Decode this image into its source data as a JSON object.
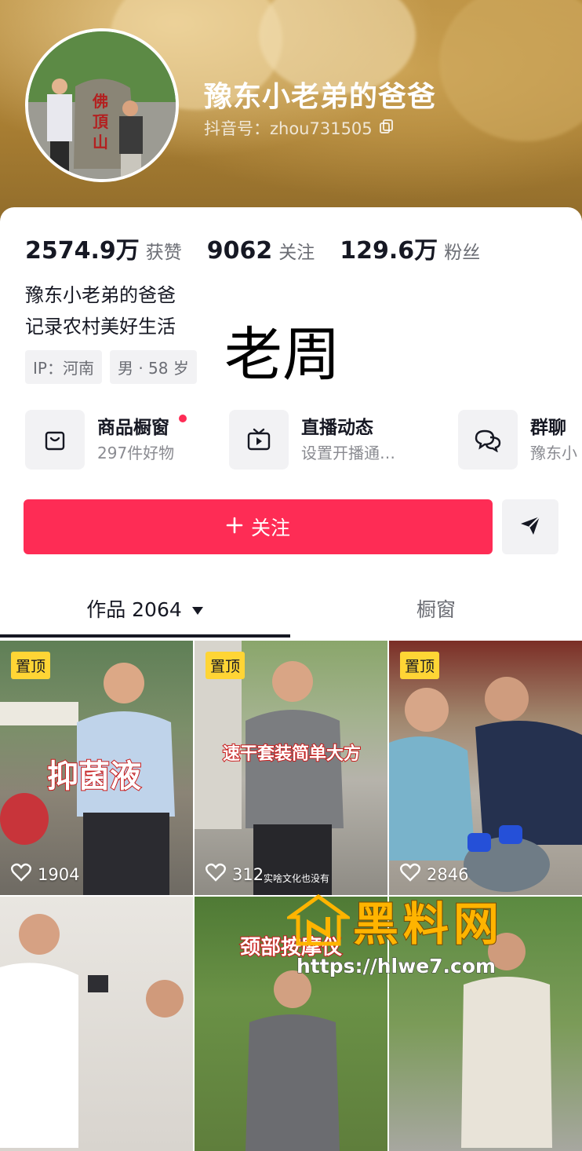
{
  "profile": {
    "name": "豫东小老弟的爸爸",
    "douyin_id": "抖音号：zhou731505",
    "avatar_sign_text": "佛頂山"
  },
  "stats": [
    {
      "value": "2574.9万",
      "label": "获赞"
    },
    {
      "value": "9062",
      "label": "关注"
    },
    {
      "value": "129.6万",
      "label": "粉丝"
    }
  ],
  "bio": {
    "line1": "豫东小老弟的爸爸",
    "line2": "记录农村美好生活"
  },
  "overlay_text": "老周",
  "tags": [
    "IP：河南",
    "男 · 58 岁"
  ],
  "features": [
    {
      "title": "商品橱窗",
      "subtitle": "297件好物",
      "icon": "bag-icon",
      "has_dot": true
    },
    {
      "title": "直播动态",
      "subtitle": "设置开播通…",
      "icon": "tv-icon",
      "has_dot": false
    },
    {
      "title": "群聊",
      "subtitle": "豫东小",
      "icon": "chat-icon",
      "has_dot": false
    }
  ],
  "actions": {
    "follow_label": "关注",
    "follow_icon": "plus-icon",
    "send_icon": "send-icon"
  },
  "tabs": {
    "works_label": "作品 2064",
    "shop_label": "橱窗"
  },
  "videos": [
    {
      "pinned": true,
      "pin_label": "置顶",
      "likes": "1904",
      "caption": "抑菌液"
    },
    {
      "pinned": true,
      "pin_label": "置顶",
      "likes": "312",
      "caption": "速干套装简单大方",
      "subtitle": "实啥文化也没有"
    },
    {
      "pinned": true,
      "pin_label": "置顶",
      "likes": "2846",
      "caption": ""
    },
    {
      "pinned": false,
      "likes": "",
      "caption": ""
    },
    {
      "pinned": false,
      "likes": "",
      "caption": "颈部按摩仪"
    },
    {
      "pinned": false,
      "likes": "",
      "caption": ""
    }
  ],
  "watermark": {
    "title": "黑料网",
    "url": "https://hlwe7.com"
  },
  "colors": {
    "accent": "#fe2c55",
    "pin": "#ffd535",
    "header": "#b88d3f"
  }
}
